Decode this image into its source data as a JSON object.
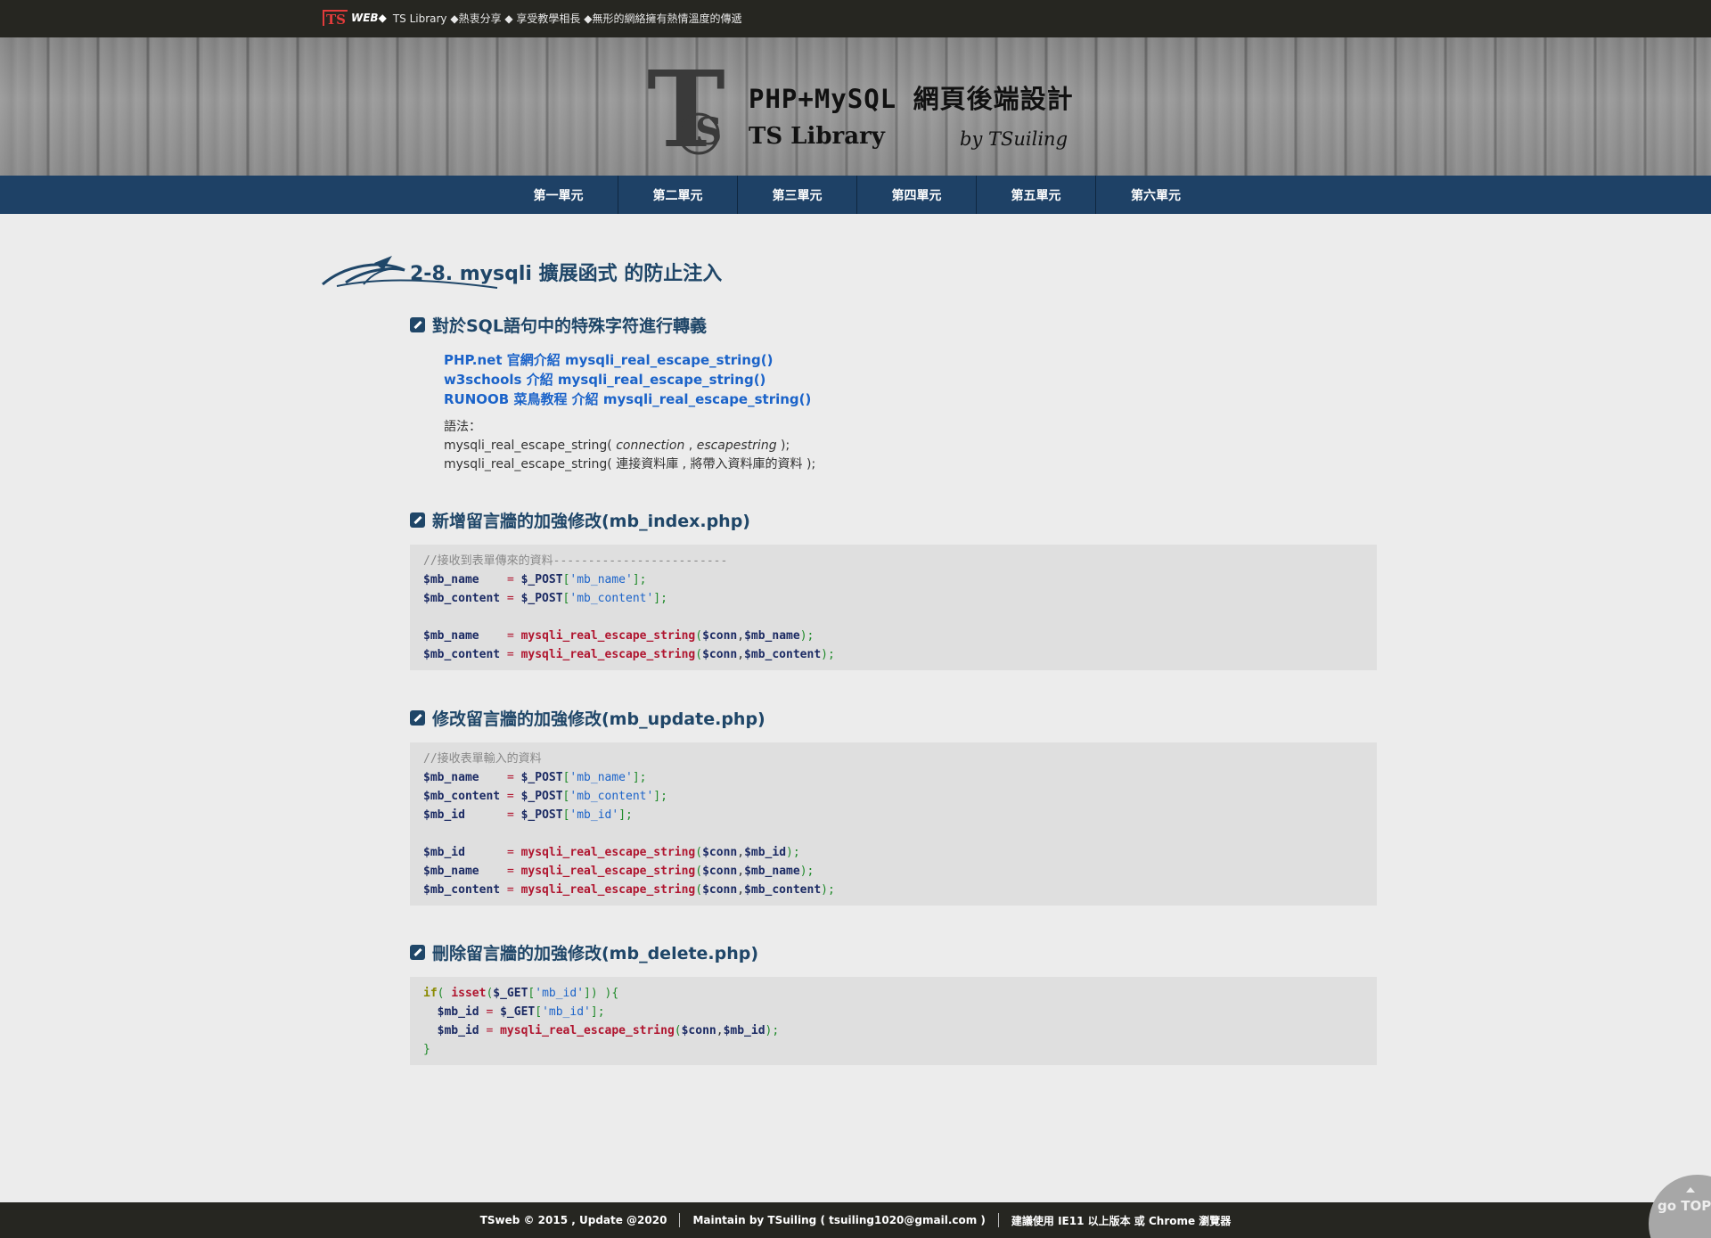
{
  "topbar": {
    "logo_ts": "TS",
    "logo_web": "WEB◆",
    "tagline": "TS Library ◆熱衷分享 ◆ 享受教學相長 ◆無形的網絡擁有熱情溫度的傳遞"
  },
  "header": {
    "brand_letter": "T",
    "brand_letter_small": "S",
    "title": "PHP+MySQL 網頁後端設計",
    "subtitle": "TS Library",
    "byline": "by TSuiling"
  },
  "nav": {
    "items": [
      {
        "label": "第一單元"
      },
      {
        "label": "第二單元"
      },
      {
        "label": "第三單元"
      },
      {
        "label": "第四單元"
      },
      {
        "label": "第五單元"
      },
      {
        "label": "第六單元"
      }
    ]
  },
  "page": {
    "title": "2-8. mysqli 擴展函式 的防止注入"
  },
  "section1": {
    "title": "對於SQL語句中的特殊字符進行轉義",
    "links": [
      {
        "label": "PHP.net 官網介紹 mysqli_real_escape_string()"
      },
      {
        "label": "w3schools 介紹 mysqli_real_escape_string()"
      },
      {
        "label": "RUNOOB 菜鳥教程 介紹 mysqli_real_escape_string()"
      }
    ],
    "syntax_label": "語法：",
    "syntax_line1_pre": "mysqli_real_escape_string( ",
    "syntax_line1_arg1": "connection",
    "syntax_line1_mid": " , ",
    "syntax_line1_arg2": "escapestring",
    "syntax_line1_post": " );",
    "syntax_line2": "mysqli_real_escape_string( 連接資料庫 , 將帶入資料庫的資料 );"
  },
  "section2": {
    "title": "新增留言牆的加強修改(mb_index.php)",
    "comment": "//接收到表單傳來的資料-------------------------"
  },
  "section3": {
    "title": "修改留言牆的加強修改(mb_update.php)",
    "comment": "//接收表單輸入的資料"
  },
  "section4": {
    "title": "刪除留言牆的加強修改(mb_delete.php)"
  },
  "code": {
    "var_name": "$mb_name",
    "var_content": "$mb_content",
    "var_id": "$mb_id",
    "var_conn": "$conn",
    "post": "$_POST",
    "get": "$_GET",
    "key_name": "'mb_name'",
    "key_content": "'mb_content'",
    "key_id": "'mb_id'",
    "fn_escape": "mysqli_real_escape_string",
    "fn_isset": "isset",
    "kw_if": "if"
  },
  "footer": {
    "copyright": "TSweb © 2015 , Update @2020",
    "maintainer": "Maintain by TSuiling ( tsuiling1020@gmail.com )",
    "browser_note": "建議使用 IE11 以上版本 或 Chrome 瀏覽器"
  },
  "gotop": {
    "label": "go TOP"
  },
  "colors": {
    "topbar": "#262621",
    "nav": "#1e4166",
    "heading": "#1f4668",
    "link": "#1b63c9",
    "code_bg": "#dfdfdf"
  }
}
